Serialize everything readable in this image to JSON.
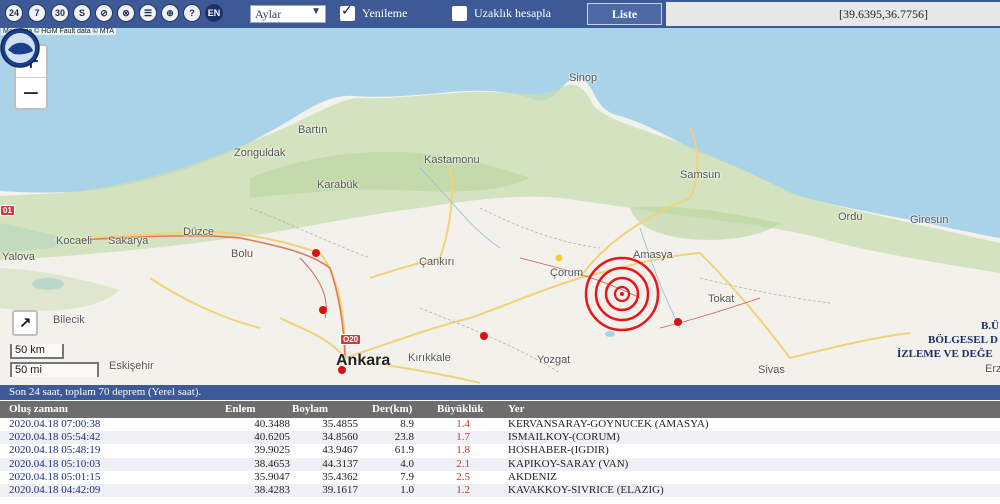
{
  "toolbar": {
    "icons": [
      {
        "name": "24-hours-button",
        "label": "24"
      },
      {
        "name": "7-days-button",
        "label": "7"
      },
      {
        "name": "30-days-button",
        "label": "30"
      },
      {
        "name": "s-button",
        "label": "S"
      },
      {
        "name": "compass-icon",
        "label": "⊘"
      },
      {
        "name": "no-signal-icon",
        "label": "⊗"
      },
      {
        "name": "list-view-icon",
        "label": "☰"
      },
      {
        "name": "crosshair-icon",
        "label": "⊕"
      },
      {
        "name": "help-icon",
        "label": "?"
      },
      {
        "name": "language-en-button",
        "label": "EN"
      }
    ],
    "period_select": "Aylar",
    "refresh_label": "Yenileme",
    "distance_label": "Uzaklık hesapla",
    "list_button": "Liste",
    "coordinates": "[39.6395,36.7756]"
  },
  "map": {
    "attribution": "Map data © HGM Fault data © MTA",
    "zoom_in": "+",
    "zoom_out": "−",
    "scale_km": "50 km",
    "scale_mi": "50 mi",
    "places": {
      "sinop": "Sinop",
      "bartin": "Bartın",
      "zonguldak": "Zonguldak",
      "kastamonu": "Kastamonu",
      "karabuk": "Karabük",
      "samsun": "Samsun",
      "ordu": "Ordu",
      "giresun": "Giresun",
      "kocaeli": "Kocaeli",
      "sakarya": "Sakarya",
      "duzce": "Düzce",
      "bolu": "Bolu",
      "yalova": "Yalova",
      "cankiri": "Çankırı",
      "corum": "Çorum",
      "amasya": "Amasya",
      "tokat": "Tokat",
      "bilecik": "Bilecik",
      "eskisehir": "Eskişehir",
      "ankara": "Ankara",
      "kirikkale": "Kırıkkale",
      "yozgat": "Yozgat",
      "sivas": "Sivas",
      "erz": "Erz"
    },
    "highway_o20": "O20",
    "highway_01": "01",
    "institution_line1": "B.Ü",
    "institution_line2": "BÖLGESEL D",
    "institution_line3": "İZLEME VE DEĞE"
  },
  "list_header": "Son 24 saat, toplam 70 deprem (Yerel saat).",
  "table": {
    "columns": [
      "Oluş zamanı",
      "Enlem",
      "Boylam",
      "Der(km)",
      "Büyüklük",
      "Yer"
    ],
    "rows": [
      [
        "2020.04.18 07:00:38",
        "40.3488",
        "35.4855",
        "8.9",
        "1.4",
        "KERVANSARAY-GOYNUCEK (AMASYA)"
      ],
      [
        "2020.04.18 05:54:42",
        "40.6205",
        "34.8560",
        "23.8",
        "1.7",
        "ISMAILKOY-(CORUM)"
      ],
      [
        "2020.04.18 05:48:19",
        "39.9025",
        "43.9467",
        "61.9",
        "1.8",
        "HOSHABER-(IGDIR)"
      ],
      [
        "2020.04.18 05:10:03",
        "38.4653",
        "44.3137",
        "4.0",
        "2.1",
        "KAPIKOY-SARAY (VAN)"
      ],
      [
        "2020.04.18 05:01:15",
        "35.9047",
        "35.4362",
        "7.9",
        "2.5",
        "AKDENIZ"
      ],
      [
        "2020.04.18 04:42:09",
        "38.4283",
        "39.1617",
        "1.0",
        "1.2",
        "KAVAKKOY-SIVRICE (ELAZIG)"
      ]
    ]
  },
  "colors": {
    "toolbar": "#3d5a96",
    "sea": "#a9d3e8",
    "epicenter": "#e8161b",
    "magnitude_text": "#c0392b"
  }
}
